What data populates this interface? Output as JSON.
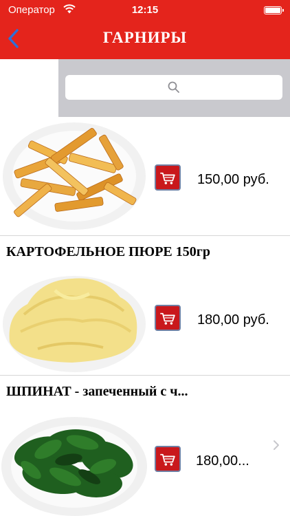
{
  "status_bar": {
    "carrier": "Оператор",
    "time": "12:15"
  },
  "nav": {
    "title": "ГАРНИРЫ",
    "back_icon": "chevron-left-icon"
  },
  "search": {
    "placeholder": "",
    "icon": "search-icon"
  },
  "items": [
    {
      "title": "",
      "price": "150,00  руб.",
      "image": "french-fries"
    },
    {
      "title": "КАРТОФЕЛЬНОЕ ПЮРЕ 150гр",
      "price": "180,00  руб.",
      "image": "mashed-potatoes"
    },
    {
      "title": "ШПИНАТ - запеченный с ч...",
      "price": "180,00...",
      "image": "baked-spinach"
    }
  ],
  "colors": {
    "nav_background": "#e4241c",
    "search_background": "#c9c9ce",
    "cart_button": "#c9181c",
    "back_arrow": "#2f6fd6"
  }
}
